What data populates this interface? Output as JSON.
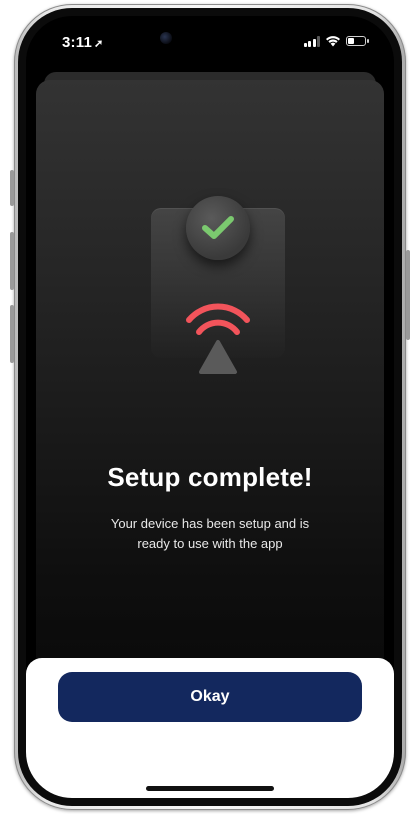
{
  "status_bar": {
    "time": "3:11",
    "location_icon": "location-arrow-icon",
    "signal_icon": "cellular-signal-icon",
    "wifi_icon": "wifi-icon",
    "battery_icon": "battery-icon",
    "battery_level": 0.3
  },
  "illustration": {
    "check_icon": "checkmark-icon",
    "waves_icon": "wireless-signal-icon",
    "check_color": "#7bc96f",
    "wave_color": "#f2545b"
  },
  "content": {
    "title": "Setup complete!",
    "message": "Your device has been setup and is ready to use with the app"
  },
  "actions": {
    "okay_label": "Okay",
    "okay_color": "#13285e"
  }
}
